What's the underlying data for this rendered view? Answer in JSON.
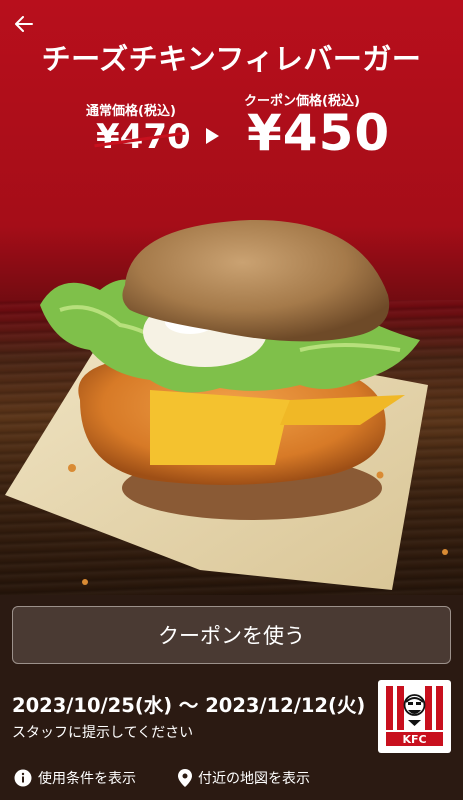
{
  "header": {
    "back_icon": "arrow-left-icon",
    "title": "チーズチキンフィレバーガー"
  },
  "pricing": {
    "regular_label": "通常価格(税込)",
    "regular_price": "¥470",
    "coupon_label": "クーポン価格(税込)",
    "coupon_price": "¥450"
  },
  "actions": {
    "use_coupon": "クーポンを使う"
  },
  "validity": {
    "dates": "2023/10/25(水) 〜 2023/12/12(火)",
    "notice": "スタッフに提示してください"
  },
  "brand": {
    "logo_text": "KFC"
  },
  "footer": {
    "terms_icon": "info-icon",
    "terms_label": "使用条件を表示",
    "map_icon": "map-pin-icon",
    "map_label": "付近の地図を表示"
  },
  "colors": {
    "brand_red": "#c8101e",
    "panel_bg": "#2b1a12"
  }
}
